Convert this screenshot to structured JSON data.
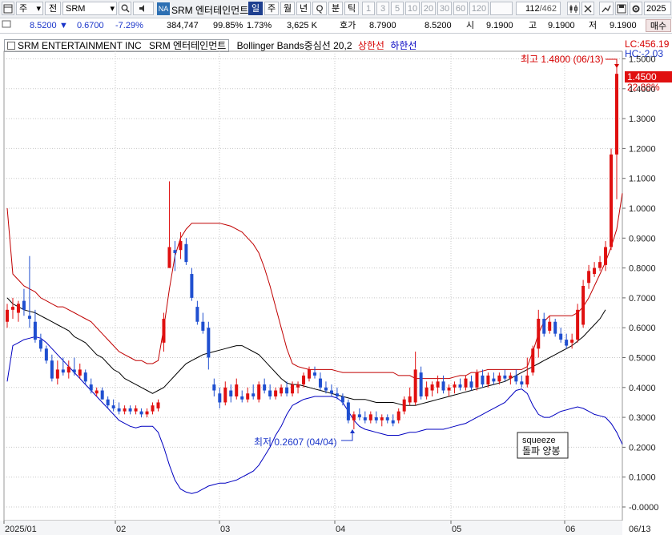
{
  "toolbar": {
    "icon_menu": "menu-icon",
    "market": "주",
    "market_arrow": "▾",
    "type": "전",
    "type_arrow": "▾",
    "symbol": "SRM",
    "symbol_arrow": "▾",
    "search_icon": "search-icon",
    "speaker_icon": "speaker-icon",
    "na_badge": "NA",
    "company_name": "SRM 엔터테인먼트",
    "periods": [
      "일",
      "주",
      "월",
      "년",
      "Q",
      "분",
      "틱"
    ],
    "active_period": "일",
    "intervals": [
      "1",
      "3",
      "5",
      "10",
      "20",
      "30",
      "60",
      "120"
    ],
    "count_display": "112",
    "count_total": "/462",
    "date": "2025"
  },
  "quote": {
    "price": "8.5200",
    "arrow": "▼",
    "change": "0.6700",
    "change_pct": "-7.29%",
    "volume": "384,747",
    "ratio1": "99.85%",
    "ratio2": "1.73%",
    "amount": "3,625 K",
    "hoga_label": "호가",
    "ask": "8.7900",
    "bid": "8.5200",
    "open_label": "시",
    "open": "9.1900",
    "high_label": "고",
    "high": "9.1900",
    "low_label": "저",
    "low": "9.1900",
    "buy_button": "매수"
  },
  "legend": {
    "name_en": "SRM ENTERTAINMENT INC",
    "name_kr": "SRM 엔터테인먼트",
    "indicator": "Bollinger Bands중심선 20,2",
    "upper": "상한선",
    "lower": "하한선"
  },
  "colors": {
    "up": "#e01010",
    "down": "#1f4fd0",
    "upper_band": "#c00000",
    "lower_band": "#0000c0",
    "middle_band": "#000000",
    "grid": "#c8c8c8"
  },
  "chart_data": {
    "type": "candlestick",
    "title": "",
    "x_labels": [
      "2025/01",
      "02",
      "03",
      "04",
      "05",
      "06",
      "06/13"
    ],
    "y_ticks": [
      "1.5000",
      "1.4000",
      "1.3000",
      "1.2000",
      "1.1000",
      "1.0000",
      "0.9000",
      "0.8000",
      "0.7000",
      "0.6000",
      "0.5000",
      "0.4000",
      "0.3000",
      "0.2000",
      "0.1000",
      "-0.0000"
    ],
    "ylim": [
      -0.02,
      1.56
    ],
    "grid": true,
    "annotations": {
      "high": "최고 1.4800 (06/13)",
      "low": "최저 0.2607 (04/04)",
      "lc": "LC:456.19",
      "hc": "HC:-2.03",
      "last_price": "1.4500",
      "last_pct": "22.88%",
      "note_line1": "squeeze",
      "note_line2": "돌파 양봉"
    },
    "candles": [
      {
        "o": 0.62,
        "h": 0.68,
        "l": 0.6,
        "c": 0.66
      },
      {
        "o": 0.66,
        "h": 0.7,
        "l": 0.63,
        "c": 0.67
      },
      {
        "o": 0.65,
        "h": 0.69,
        "l": 0.62,
        "c": 0.68
      },
      {
        "o": 0.69,
        "h": 0.73,
        "l": 0.64,
        "c": 0.66
      },
      {
        "o": 0.64,
        "h": 0.84,
        "l": 0.6,
        "c": 0.63
      },
      {
        "o": 0.62,
        "h": 0.66,
        "l": 0.55,
        "c": 0.56
      },
      {
        "o": 0.56,
        "h": 0.58,
        "l": 0.52,
        "c": 0.53
      },
      {
        "o": 0.53,
        "h": 0.54,
        "l": 0.48,
        "c": 0.49
      },
      {
        "o": 0.49,
        "h": 0.51,
        "l": 0.42,
        "c": 0.43
      },
      {
        "o": 0.43,
        "h": 0.49,
        "l": 0.41,
        "c": 0.46
      },
      {
        "o": 0.46,
        "h": 0.5,
        "l": 0.44,
        "c": 0.45
      },
      {
        "o": 0.45,
        "h": 0.49,
        "l": 0.43,
        "c": 0.47
      },
      {
        "o": 0.46,
        "h": 0.5,
        "l": 0.44,
        "c": 0.45
      },
      {
        "o": 0.44,
        "h": 0.48,
        "l": 0.43,
        "c": 0.46
      },
      {
        "o": 0.45,
        "h": 0.46,
        "l": 0.41,
        "c": 0.42
      },
      {
        "o": 0.41,
        "h": 0.43,
        "l": 0.38,
        "c": 0.39
      },
      {
        "o": 0.38,
        "h": 0.4,
        "l": 0.37,
        "c": 0.39
      },
      {
        "o": 0.39,
        "h": 0.4,
        "l": 0.36,
        "c": 0.36
      },
      {
        "o": 0.36,
        "h": 0.37,
        "l": 0.33,
        "c": 0.34
      },
      {
        "o": 0.34,
        "h": 0.36,
        "l": 0.32,
        "c": 0.33
      },
      {
        "o": 0.33,
        "h": 0.35,
        "l": 0.31,
        "c": 0.32
      },
      {
        "o": 0.32,
        "h": 0.34,
        "l": 0.31,
        "c": 0.33
      },
      {
        "o": 0.33,
        "h": 0.34,
        "l": 0.31,
        "c": 0.32
      },
      {
        "o": 0.32,
        "h": 0.34,
        "l": 0.31,
        "c": 0.33
      },
      {
        "o": 0.32,
        "h": 0.33,
        "l": 0.3,
        "c": 0.31
      },
      {
        "o": 0.31,
        "h": 0.33,
        "l": 0.3,
        "c": 0.32
      },
      {
        "o": 0.32,
        "h": 0.35,
        "l": 0.31,
        "c": 0.34
      },
      {
        "o": 0.33,
        "h": 0.36,
        "l": 0.32,
        "c": 0.35
      },
      {
        "o": 0.55,
        "h": 0.65,
        "l": 0.52,
        "c": 0.63
      },
      {
        "o": 0.8,
        "h": 1.09,
        "l": 0.8,
        "c": 0.87
      },
      {
        "o": 0.86,
        "h": 0.89,
        "l": 0.79,
        "c": 0.85
      },
      {
        "o": 0.86,
        "h": 0.92,
        "l": 0.83,
        "c": 0.89
      },
      {
        "o": 0.88,
        "h": 0.9,
        "l": 0.81,
        "c": 0.82
      },
      {
        "o": 0.78,
        "h": 0.8,
        "l": 0.69,
        "c": 0.7
      },
      {
        "o": 0.67,
        "h": 0.69,
        "l": 0.61,
        "c": 0.62
      },
      {
        "o": 0.62,
        "h": 0.65,
        "l": 0.58,
        "c": 0.59
      },
      {
        "o": 0.6,
        "h": 0.62,
        "l": 0.46,
        "c": 0.5
      },
      {
        "o": 0.41,
        "h": 0.43,
        "l": 0.37,
        "c": 0.39
      },
      {
        "o": 0.38,
        "h": 0.4,
        "l": 0.33,
        "c": 0.35
      },
      {
        "o": 0.35,
        "h": 0.42,
        "l": 0.34,
        "c": 0.4
      },
      {
        "o": 0.39,
        "h": 0.41,
        "l": 0.35,
        "c": 0.37
      },
      {
        "o": 0.37,
        "h": 0.43,
        "l": 0.36,
        "c": 0.41
      },
      {
        "o": 0.37,
        "h": 0.39,
        "l": 0.35,
        "c": 0.36
      },
      {
        "o": 0.36,
        "h": 0.4,
        "l": 0.35,
        "c": 0.38
      },
      {
        "o": 0.38,
        "h": 0.41,
        "l": 0.36,
        "c": 0.37
      },
      {
        "o": 0.36,
        "h": 0.42,
        "l": 0.35,
        "c": 0.41
      },
      {
        "o": 0.41,
        "h": 0.43,
        "l": 0.38,
        "c": 0.39
      },
      {
        "o": 0.39,
        "h": 0.41,
        "l": 0.36,
        "c": 0.37
      },
      {
        "o": 0.37,
        "h": 0.4,
        "l": 0.36,
        "c": 0.39
      },
      {
        "o": 0.38,
        "h": 0.41,
        "l": 0.37,
        "c": 0.4
      },
      {
        "o": 0.4,
        "h": 0.42,
        "l": 0.37,
        "c": 0.38
      },
      {
        "o": 0.38,
        "h": 0.42,
        "l": 0.37,
        "c": 0.41
      },
      {
        "o": 0.4,
        "h": 0.42,
        "l": 0.38,
        "c": 0.41
      },
      {
        "o": 0.41,
        "h": 0.45,
        "l": 0.4,
        "c": 0.44
      },
      {
        "o": 0.43,
        "h": 0.47,
        "l": 0.42,
        "c": 0.46
      },
      {
        "o": 0.45,
        "h": 0.47,
        "l": 0.43,
        "c": 0.44
      },
      {
        "o": 0.43,
        "h": 0.45,
        "l": 0.39,
        "c": 0.4
      },
      {
        "o": 0.4,
        "h": 0.42,
        "l": 0.38,
        "c": 0.39
      },
      {
        "o": 0.39,
        "h": 0.41,
        "l": 0.37,
        "c": 0.38
      },
      {
        "o": 0.38,
        "h": 0.4,
        "l": 0.36,
        "c": 0.37
      },
      {
        "o": 0.37,
        "h": 0.38,
        "l": 0.34,
        "c": 0.35
      },
      {
        "o": 0.35,
        "h": 0.36,
        "l": 0.28,
        "c": 0.29
      },
      {
        "o": 0.29,
        "h": 0.32,
        "l": 0.26,
        "c": 0.31
      },
      {
        "o": 0.31,
        "h": 0.33,
        "l": 0.29,
        "c": 0.3
      },
      {
        "o": 0.3,
        "h": 0.32,
        "l": 0.28,
        "c": 0.29
      },
      {
        "o": 0.29,
        "h": 0.32,
        "l": 0.28,
        "c": 0.31
      },
      {
        "o": 0.3,
        "h": 0.32,
        "l": 0.28,
        "c": 0.29
      },
      {
        "o": 0.29,
        "h": 0.31,
        "l": 0.27,
        "c": 0.3
      },
      {
        "o": 0.3,
        "h": 0.31,
        "l": 0.28,
        "c": 0.29
      },
      {
        "o": 0.29,
        "h": 0.31,
        "l": 0.27,
        "c": 0.28
      },
      {
        "o": 0.29,
        "h": 0.33,
        "l": 0.28,
        "c": 0.32
      },
      {
        "o": 0.32,
        "h": 0.37,
        "l": 0.31,
        "c": 0.36
      },
      {
        "o": 0.35,
        "h": 0.4,
        "l": 0.34,
        "c": 0.37
      },
      {
        "o": 0.35,
        "h": 0.52,
        "l": 0.34,
        "c": 0.46
      },
      {
        "o": 0.45,
        "h": 0.47,
        "l": 0.36,
        "c": 0.37
      },
      {
        "o": 0.37,
        "h": 0.42,
        "l": 0.36,
        "c": 0.4
      },
      {
        "o": 0.39,
        "h": 0.42,
        "l": 0.37,
        "c": 0.41
      },
      {
        "o": 0.4,
        "h": 0.44,
        "l": 0.38,
        "c": 0.42
      },
      {
        "o": 0.42,
        "h": 0.44,
        "l": 0.38,
        "c": 0.39
      },
      {
        "o": 0.39,
        "h": 0.41,
        "l": 0.37,
        "c": 0.4
      },
      {
        "o": 0.4,
        "h": 0.42,
        "l": 0.38,
        "c": 0.41
      },
      {
        "o": 0.41,
        "h": 0.43,
        "l": 0.39,
        "c": 0.4
      },
      {
        "o": 0.4,
        "h": 0.44,
        "l": 0.39,
        "c": 0.43
      },
      {
        "o": 0.42,
        "h": 0.44,
        "l": 0.39,
        "c": 0.4
      },
      {
        "o": 0.4,
        "h": 0.46,
        "l": 0.39,
        "c": 0.45
      },
      {
        "o": 0.44,
        "h": 0.46,
        "l": 0.4,
        "c": 0.41
      },
      {
        "o": 0.41,
        "h": 0.45,
        "l": 0.4,
        "c": 0.44
      },
      {
        "o": 0.43,
        "h": 0.45,
        "l": 0.41,
        "c": 0.42
      },
      {
        "o": 0.42,
        "h": 0.45,
        "l": 0.41,
        "c": 0.44
      },
      {
        "o": 0.44,
        "h": 0.46,
        "l": 0.42,
        "c": 0.43
      },
      {
        "o": 0.43,
        "h": 0.45,
        "l": 0.41,
        "c": 0.44
      },
      {
        "o": 0.44,
        "h": 0.46,
        "l": 0.41,
        "c": 0.42
      },
      {
        "o": 0.42,
        "h": 0.44,
        "l": 0.4,
        "c": 0.41
      },
      {
        "o": 0.41,
        "h": 0.5,
        "l": 0.4,
        "c": 0.44
      },
      {
        "o": 0.45,
        "h": 0.54,
        "l": 0.44,
        "c": 0.53
      },
      {
        "o": 0.53,
        "h": 0.66,
        "l": 0.5,
        "c": 0.63
      },
      {
        "o": 0.63,
        "h": 0.65,
        "l": 0.57,
        "c": 0.58
      },
      {
        "o": 0.59,
        "h": 0.64,
        "l": 0.58,
        "c": 0.62
      },
      {
        "o": 0.62,
        "h": 0.63,
        "l": 0.57,
        "c": 0.58
      },
      {
        "o": 0.58,
        "h": 0.6,
        "l": 0.55,
        "c": 0.56
      },
      {
        "o": 0.56,
        "h": 0.58,
        "l": 0.53,
        "c": 0.54
      },
      {
        "o": 0.55,
        "h": 0.58,
        "l": 0.53,
        "c": 0.56
      },
      {
        "o": 0.56,
        "h": 0.68,
        "l": 0.55,
        "c": 0.66
      },
      {
        "o": 0.61,
        "h": 0.76,
        "l": 0.6,
        "c": 0.74
      },
      {
        "o": 0.75,
        "h": 0.81,
        "l": 0.73,
        "c": 0.79
      },
      {
        "o": 0.78,
        "h": 0.82,
        "l": 0.77,
        "c": 0.8
      },
      {
        "o": 0.8,
        "h": 0.84,
        "l": 0.79,
        "c": 0.82
      },
      {
        "o": 0.81,
        "h": 0.89,
        "l": 0.79,
        "c": 0.87
      },
      {
        "o": 0.87,
        "h": 1.2,
        "l": 0.86,
        "c": 1.18
      },
      {
        "o": 1.18,
        "h": 1.48,
        "l": 1.03,
        "c": 1.45
      }
    ],
    "upper_band": [
      1.0,
      0.78,
      0.76,
      0.74,
      0.73,
      0.72,
      0.7,
      0.69,
      0.68,
      0.67,
      0.67,
      0.66,
      0.65,
      0.64,
      0.63,
      0.62,
      0.6,
      0.58,
      0.56,
      0.54,
      0.52,
      0.51,
      0.5,
      0.49,
      0.49,
      0.48,
      0.48,
      0.49,
      0.6,
      0.73,
      0.84,
      0.9,
      0.93,
      0.95,
      0.95,
      0.95,
      0.95,
      0.95,
      0.95,
      0.945,
      0.94,
      0.93,
      0.92,
      0.9,
      0.88,
      0.85,
      0.8,
      0.74,
      0.67,
      0.6,
      0.53,
      0.48,
      0.47,
      0.465,
      0.46,
      0.46,
      0.46,
      0.46,
      0.46,
      0.455,
      0.45,
      0.45,
      0.45,
      0.45,
      0.45,
      0.45,
      0.45,
      0.45,
      0.45,
      0.45,
      0.44,
      0.44,
      0.44,
      0.43,
      0.43,
      0.43,
      0.43,
      0.43,
      0.43,
      0.43,
      0.435,
      0.44,
      0.44,
      0.45,
      0.45,
      0.455,
      0.46,
      0.46,
      0.46,
      0.46,
      0.46,
      0.46,
      0.46,
      0.47,
      0.52,
      0.58,
      0.62,
      0.64,
      0.64,
      0.64,
      0.64,
      0.64,
      0.65,
      0.67,
      0.7,
      0.74,
      0.78,
      0.82,
      0.87,
      0.93,
      1.05
    ],
    "middle_band": [
      0.7,
      0.68,
      0.67,
      0.66,
      0.655,
      0.65,
      0.64,
      0.63,
      0.62,
      0.61,
      0.6,
      0.59,
      0.57,
      0.56,
      0.55,
      0.53,
      0.51,
      0.5,
      0.48,
      0.46,
      0.45,
      0.43,
      0.42,
      0.41,
      0.4,
      0.39,
      0.38,
      0.39,
      0.4,
      0.42,
      0.44,
      0.46,
      0.48,
      0.49,
      0.5,
      0.51,
      0.515,
      0.52,
      0.525,
      0.53,
      0.535,
      0.54,
      0.54,
      0.53,
      0.52,
      0.51,
      0.49,
      0.47,
      0.45,
      0.43,
      0.415,
      0.41,
      0.41,
      0.405,
      0.4,
      0.395,
      0.39,
      0.385,
      0.38,
      0.375,
      0.37,
      0.365,
      0.36,
      0.36,
      0.36,
      0.355,
      0.35,
      0.35,
      0.35,
      0.35,
      0.345,
      0.34,
      0.34,
      0.34,
      0.345,
      0.35,
      0.355,
      0.36,
      0.365,
      0.37,
      0.375,
      0.38,
      0.385,
      0.39,
      0.395,
      0.4,
      0.405,
      0.41,
      0.415,
      0.42,
      0.43,
      0.44,
      0.45,
      0.46,
      0.47,
      0.48,
      0.49,
      0.5,
      0.51,
      0.52,
      0.53,
      0.54,
      0.555,
      0.57,
      0.59,
      0.61,
      0.63,
      0.66
    ],
    "lower_band": [
      0.42,
      0.54,
      0.55,
      0.56,
      0.565,
      0.57,
      0.565,
      0.55,
      0.53,
      0.51,
      0.49,
      0.47,
      0.45,
      0.43,
      0.41,
      0.39,
      0.37,
      0.35,
      0.33,
      0.31,
      0.29,
      0.28,
      0.27,
      0.265,
      0.27,
      0.27,
      0.27,
      0.25,
      0.2,
      0.14,
      0.09,
      0.06,
      0.05,
      0.045,
      0.05,
      0.06,
      0.07,
      0.075,
      0.08,
      0.08,
      0.085,
      0.09,
      0.1,
      0.11,
      0.12,
      0.14,
      0.17,
      0.2,
      0.24,
      0.27,
      0.31,
      0.34,
      0.35,
      0.36,
      0.365,
      0.37,
      0.37,
      0.37,
      0.37,
      0.365,
      0.35,
      0.32,
      0.29,
      0.27,
      0.26,
      0.255,
      0.25,
      0.245,
      0.24,
      0.24,
      0.24,
      0.245,
      0.25,
      0.25,
      0.255,
      0.26,
      0.26,
      0.26,
      0.26,
      0.265,
      0.27,
      0.275,
      0.28,
      0.29,
      0.3,
      0.31,
      0.32,
      0.33,
      0.34,
      0.35,
      0.37,
      0.39,
      0.395,
      0.38,
      0.34,
      0.31,
      0.3,
      0.3,
      0.31,
      0.32,
      0.325,
      0.33,
      0.335,
      0.33,
      0.32,
      0.31,
      0.305,
      0.3,
      0.28,
      0.25,
      0.21
    ]
  }
}
